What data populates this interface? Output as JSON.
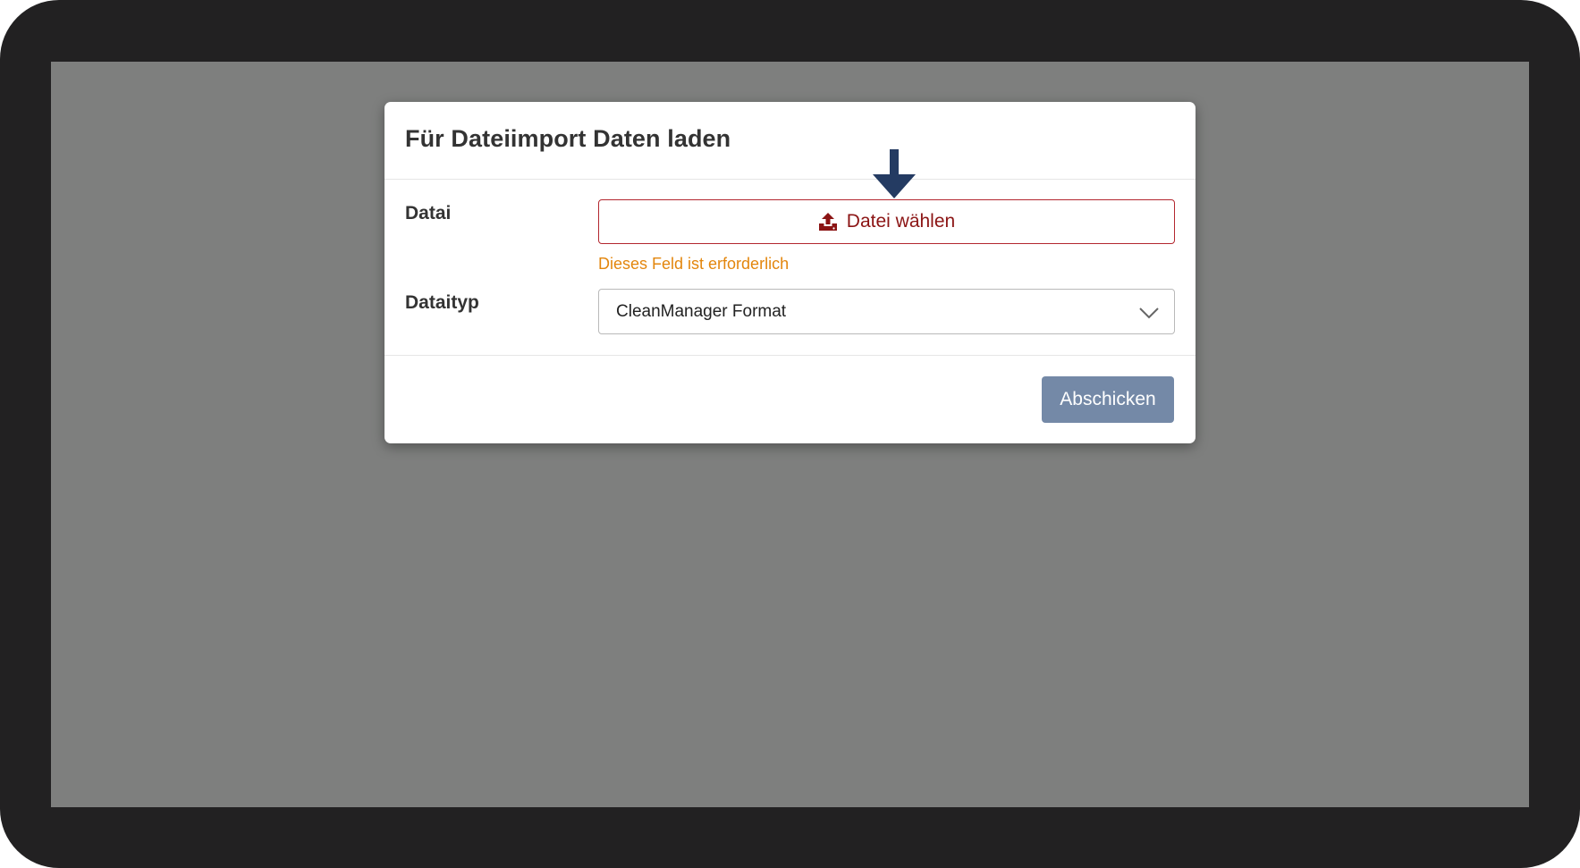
{
  "modal": {
    "title": "Für Dateiimport Daten laden"
  },
  "form": {
    "file_label": "Datai",
    "file_button_label": "Datei wählen",
    "file_button_icon": "upload-icon",
    "file_error": "Dieses Feld ist erforderlich",
    "type_label": "Dataityp",
    "type_selected": "CleanManager Format",
    "type_icon": "chevron-down-icon"
  },
  "footer": {
    "submit_label": "Abschicken"
  },
  "colors": {
    "frame": "#222122",
    "overlay": "#7e7f7e",
    "error_border": "#b3272f",
    "error_text": "#e3860d",
    "button_text": "#8b1414",
    "submit_bg": "#7489a7",
    "arrow": "#243b62"
  },
  "annotation": {
    "icon": "down-arrow-icon"
  }
}
